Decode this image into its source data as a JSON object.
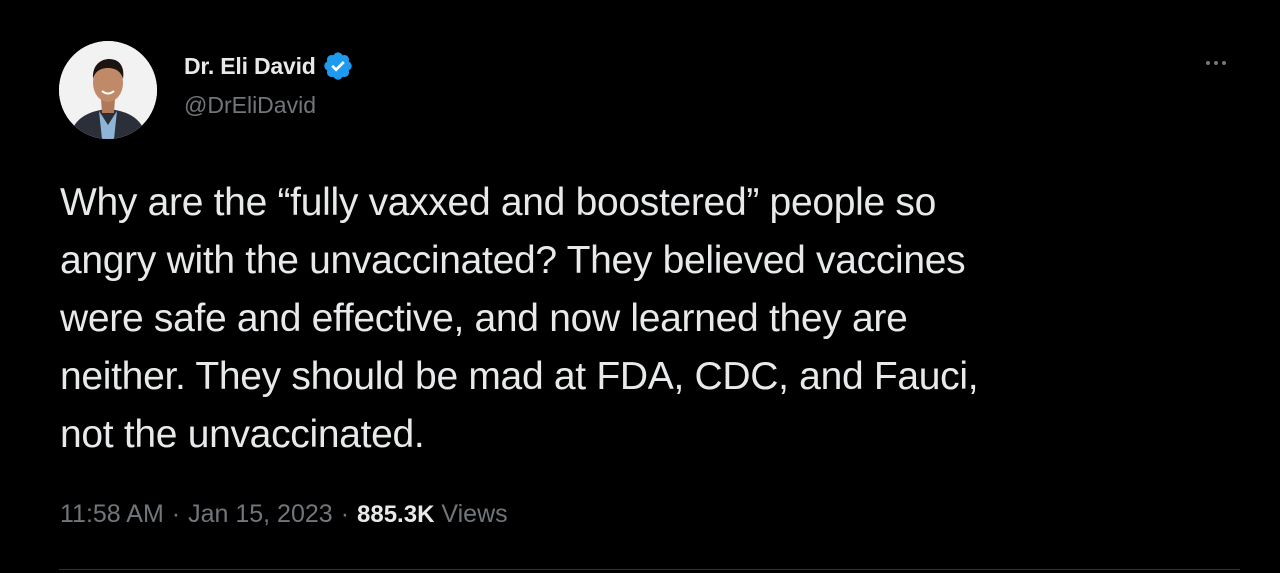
{
  "author": {
    "display_name": "Dr. Eli David",
    "handle": "@DrEliDavid",
    "verified": true,
    "avatar_icon": "profile-photo"
  },
  "tweet": {
    "text_lines": [
      "Why are the “fully vaxxed and boostered” people so",
      "angry with the unvaccinated? They believed vaccines",
      "were safe and effective, and now learned they are",
      "neither. They should be mad at FDA, CDC, and Fauci,",
      "not the unvaccinated."
    ]
  },
  "meta": {
    "time": "11:58 AM",
    "separator": "·",
    "date": "Jan 15, 2023",
    "views_count": "885.3K",
    "views_label": "Views"
  },
  "icons": {
    "verified": "verified-badge-icon",
    "more": "more-options-icon"
  },
  "colors": {
    "background": "#000000",
    "text_primary": "#e7e9ea",
    "text_secondary": "#71767b",
    "verified_blue": "#1d9bf0",
    "divider": "#2f3336"
  }
}
